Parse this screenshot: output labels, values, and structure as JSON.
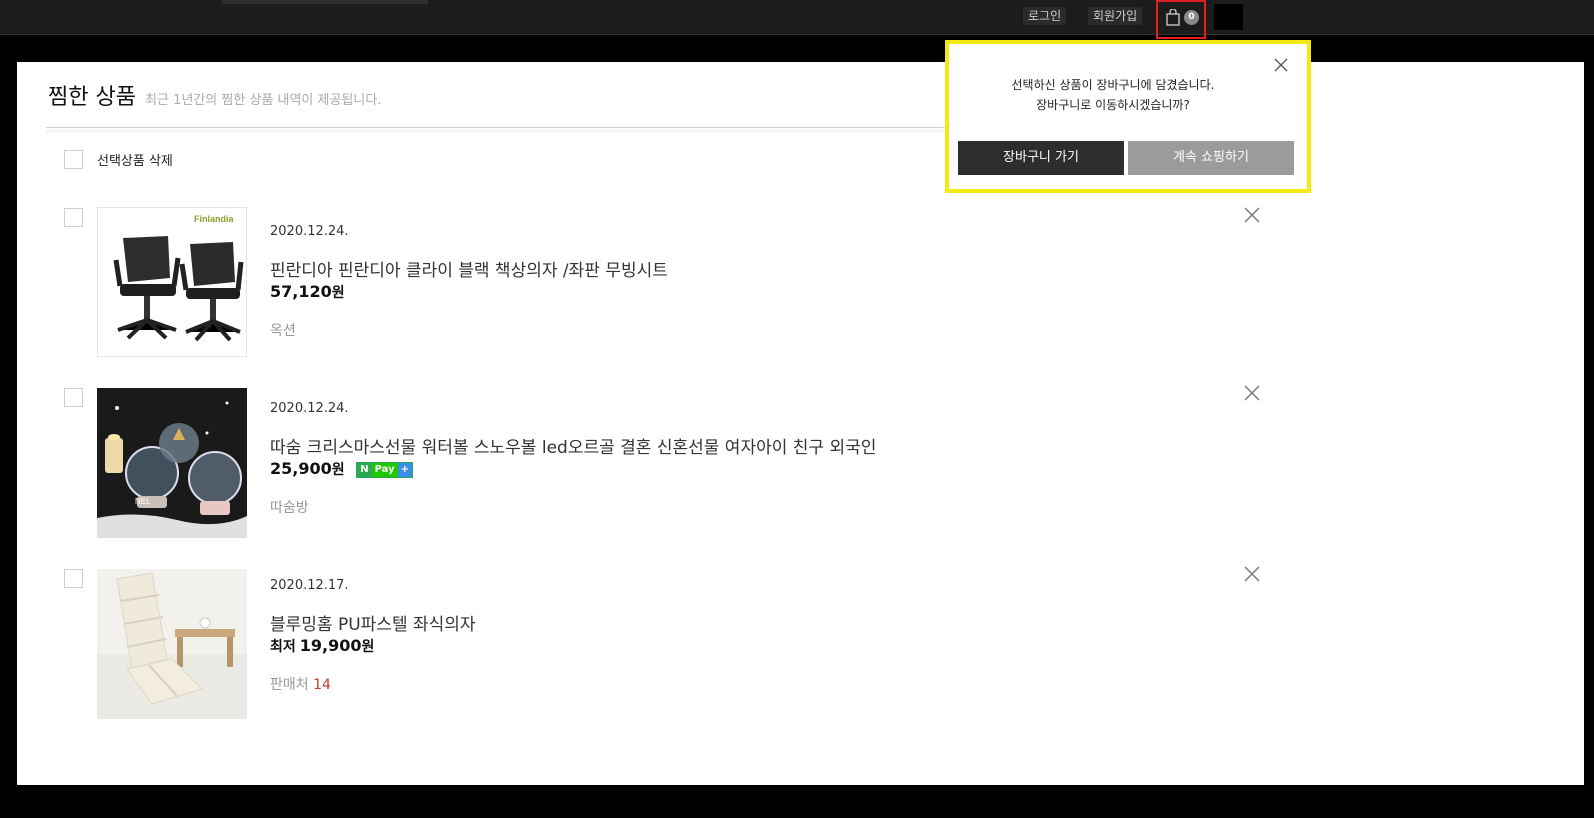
{
  "header": {
    "login_label": "로그인",
    "signup_label": "회원가입",
    "cart_count": "0"
  },
  "page": {
    "title": "찜한 상품",
    "subtitle": "최근 1년간의 찜한 상품 내역이 제공됩니다.",
    "delete_selected_label": "선택상품 삭제"
  },
  "items": [
    {
      "date": "2020.12.24.",
      "title": "핀란디아 핀란디아 클라이 블랙 책상의자 /좌판 무빙시트",
      "price": "57,120",
      "currency": "원",
      "seller": "옥션",
      "thumb_brand": "Finlandia"
    },
    {
      "date": "2020.12.24.",
      "title": "따숨 크리스마스선물 워터볼 스노우볼 led오르골 결혼 신혼선물 여자아이 친구 외국인",
      "price": "25,900",
      "currency": "원",
      "seller": "따숨방",
      "npay": {
        "n": "N",
        "pay": "Pay",
        "plus": "+"
      }
    },
    {
      "date": "2020.12.17.",
      "title": "블루밍홈 PU파스텔 좌식의자",
      "price_prefix": "최저",
      "price": "19,900",
      "currency": "원",
      "seller_label": "판매처",
      "seller_count": "14"
    }
  ],
  "popup": {
    "message_line1": "선택하신 상품이 장바구니에 담겼습니다.",
    "message_line2": "장바구니로 이동하시겠습니까?",
    "go_cart_label": "장바구니 가기",
    "continue_label": "계속 쇼핑하기"
  },
  "colors": {
    "highlight_cart": "#e02020",
    "popup_border": "#f3e80f",
    "npay_green": "#1ec800"
  }
}
